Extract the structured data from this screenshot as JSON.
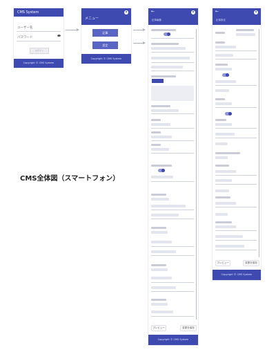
{
  "caption": "CMS全体図（スマートフォン）",
  "login": {
    "title": "CMS System",
    "user_placeholder": "ユーザー名",
    "password_placeholder": "パスワード",
    "login_button": "ログイン",
    "footer": "Copyright © CMS System"
  },
  "menu": {
    "title": "メニュー",
    "item1": "記事",
    "item2": "設定",
    "footer": "Copyright © CMS System"
  },
  "edit": {
    "title": "記事編集",
    "back_icon": "arrow-left",
    "avatar_icon": "account-circle",
    "preview_button": "プレビュー",
    "save_button": "変更を保存",
    "footer": "Copyright © CMS System"
  },
  "detail": {
    "title": "記事設定",
    "preview_button": "プレビュー",
    "save_button": "変更を保存",
    "footer": "Copyright © CMS System"
  },
  "colors": {
    "brand": "#3f4ab0",
    "brand_light": "#5a64c2"
  }
}
